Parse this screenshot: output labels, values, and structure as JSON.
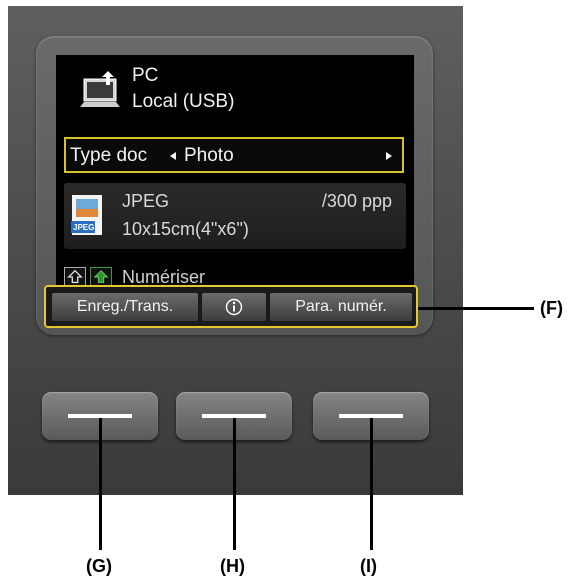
{
  "destination": {
    "title": "PC",
    "subtitle": "Local (USB)",
    "icon": "computer-upload-icon"
  },
  "doc_type": {
    "label": "Type doc",
    "value": "Photo"
  },
  "format": {
    "type": "JPEG",
    "resolution": "/300 ppp",
    "size": "10x15cm(4\"x6\")",
    "icon": "jpeg-file-icon"
  },
  "scan": {
    "label": "Numériser"
  },
  "function_bar": {
    "left_label": "Enreg./Trans.",
    "middle_icon": "info-icon",
    "right_label": "Para. numér."
  },
  "soft_keys": [
    "G",
    "H",
    "I"
  ],
  "callouts": {
    "function_bar": "(F)",
    "left_key": "(G)",
    "center_key": "(H)",
    "right_key": "(I)"
  },
  "colors": {
    "highlight": "#e3c92e",
    "screen_bg": "#000000",
    "panel_bg": "#4a4a4a"
  }
}
